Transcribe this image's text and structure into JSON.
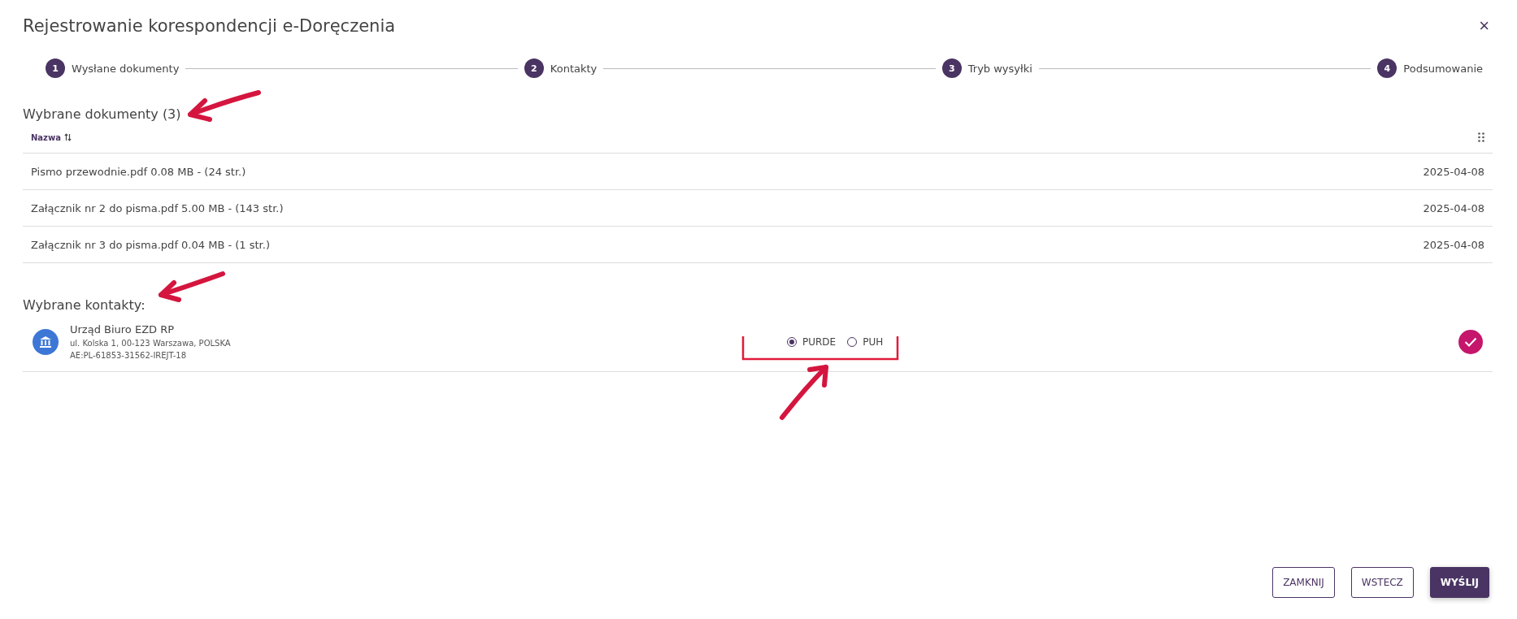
{
  "dialog": {
    "title": "Rejestrowanie korespondencji e-Doręczenia",
    "close": "×"
  },
  "steps": [
    {
      "number": "1",
      "label": "Wysłane dokumenty"
    },
    {
      "number": "2",
      "label": "Kontakty"
    },
    {
      "number": "3",
      "label": "Tryb wysyłki"
    },
    {
      "number": "4",
      "label": "Podsumowanie"
    }
  ],
  "documents": {
    "heading": "Wybrane dokumenty (3)",
    "column": "Nazwa",
    "rows": [
      {
        "name": "Pismo przewodnie.pdf 0.08 MB - (24 str.)",
        "date": "2025-04-08"
      },
      {
        "name": "Załącznik nr 2 do pisma.pdf 5.00 MB - (143 str.)",
        "date": "2025-04-08"
      },
      {
        "name": "Załącznik nr 3 do pisma.pdf 0.04 MB - (1 str.)",
        "date": "2025-04-08"
      }
    ]
  },
  "contacts": {
    "heading": "Wybrane kontakty:",
    "items": [
      {
        "name": "Urząd Biuro EZD RP",
        "address": "ul. Kolska 1, 00-123 Warszawa, POLSKA",
        "box": "AE:PL-61853-31562-IREJT-18",
        "checked": true,
        "modes": [
          {
            "label": "PURDE",
            "selected": true
          },
          {
            "label": "PUH",
            "selected": false
          }
        ]
      }
    ]
  },
  "buttons": [
    {
      "label": "ZAMKNIJ",
      "kind": "outline"
    },
    {
      "label": "WSTECZ",
      "kind": "outline"
    },
    {
      "label": "WYŚLIJ",
      "kind": "primary"
    }
  ]
}
